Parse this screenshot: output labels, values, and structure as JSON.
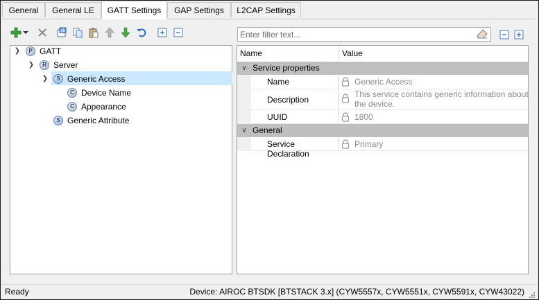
{
  "tabs": [
    {
      "label": "General",
      "active": false
    },
    {
      "label": "General LE",
      "active": false
    },
    {
      "label": "GATT Settings",
      "active": true
    },
    {
      "label": "GAP Settings",
      "active": false
    },
    {
      "label": "L2CAP Settings",
      "active": false
    }
  ],
  "toolbar": {
    "icons": [
      "add-icon",
      "dropdown-arrow-icon",
      "delete-icon",
      "rename-icon",
      "copy-icon",
      "paste-icon",
      "move-up-icon",
      "move-down-icon",
      "undo-icon",
      "expand-all-icon",
      "collapse-all-icon"
    ]
  },
  "filter": {
    "placeholder": "Enter filter text...",
    "value": ""
  },
  "grid_toolbar": {
    "icons": [
      "collapse-all-icon",
      "expand-all-icon"
    ]
  },
  "tree": {
    "nodes": [
      {
        "label": "GATT",
        "badge": "P",
        "level": 0,
        "expanded": true
      },
      {
        "label": "Server",
        "badge": "R",
        "level": 1,
        "expanded": true
      },
      {
        "label": "Generic Access",
        "badge": "S",
        "level": 2,
        "expanded": true,
        "selected": true
      },
      {
        "label": "Device Name",
        "badge": "C",
        "level": 3
      },
      {
        "label": "Appearance",
        "badge": "C",
        "level": 3
      },
      {
        "label": "Generic Attribute",
        "badge": "S",
        "level": 2
      }
    ]
  },
  "grid": {
    "headers": {
      "name": "Name",
      "value": "Value"
    },
    "categories": [
      {
        "label": "Service properties",
        "rows": [
          {
            "name": "Name",
            "value": "Generic Access"
          },
          {
            "name": "Description",
            "value_line1": "This service contains generic information about",
            "value_line2": "the device."
          },
          {
            "name": "UUID",
            "value": "1800"
          }
        ]
      },
      {
        "label": "General",
        "rows": [
          {
            "name": "Service Declaration",
            "value": "Primary"
          }
        ]
      }
    ]
  },
  "status": {
    "left": "Ready",
    "right": "Device: AIROC BTSDK [BTSTACK 3.x] (CYW5557x, CYW5551x, CYW5591x, CYW43022)"
  }
}
